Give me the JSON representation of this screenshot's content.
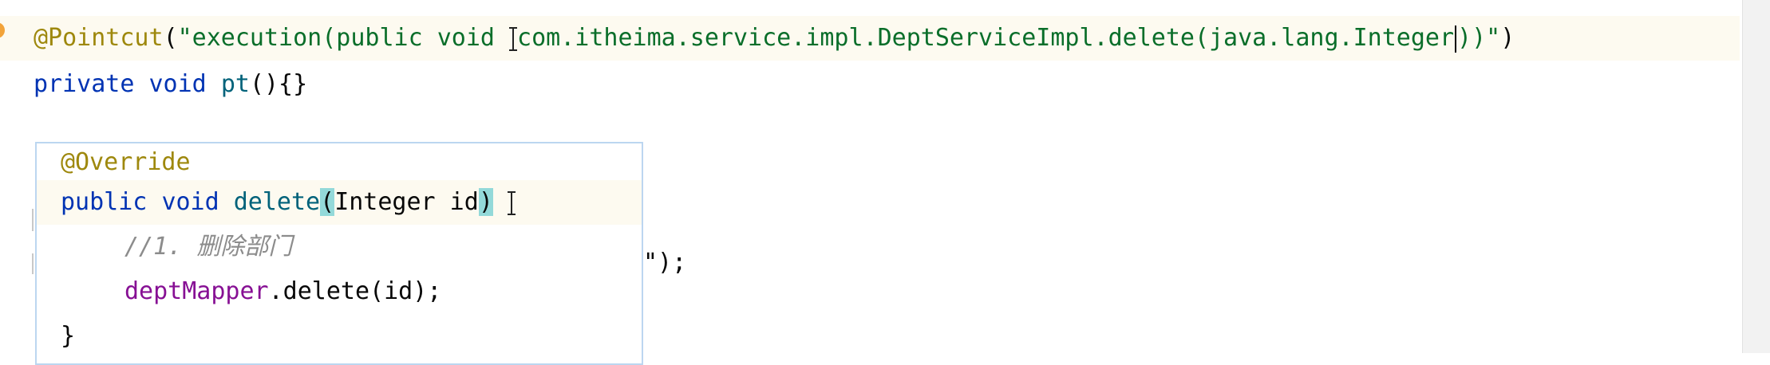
{
  "editor": {
    "line1": {
      "annotation": "@Pointcut",
      "open": "(",
      "str_a": "\"execution(public void ",
      "str_b": "com.itheima.service.impl.DeptServiceImpl.delete(java.lang.Integer",
      "str_c": "))\"",
      "close": ")"
    },
    "line2": {
      "kw1": "private",
      "kw2": "void",
      "method": "pt",
      "tail": "(){}"
    },
    "trail_text": "\");"
  },
  "popup": {
    "annotation": "@Override",
    "sig": {
      "kw1": "public",
      "kw2": "void",
      "method": "delete",
      "open_paren": "(",
      "params": "Integer id",
      "close_paren": ")"
    },
    "comment": "//1. 删除部门",
    "call": {
      "field": "deptMapper",
      "rest": ".delete(id);"
    },
    "close_brace": "}"
  },
  "colors": {
    "annotation": "#9e880d",
    "string": "#0a6e2a",
    "keyword": "#0033b3",
    "method": "#00627a",
    "field": "#871094",
    "comment": "#8c8c8c",
    "paren_highlight": "#93d9d9"
  }
}
